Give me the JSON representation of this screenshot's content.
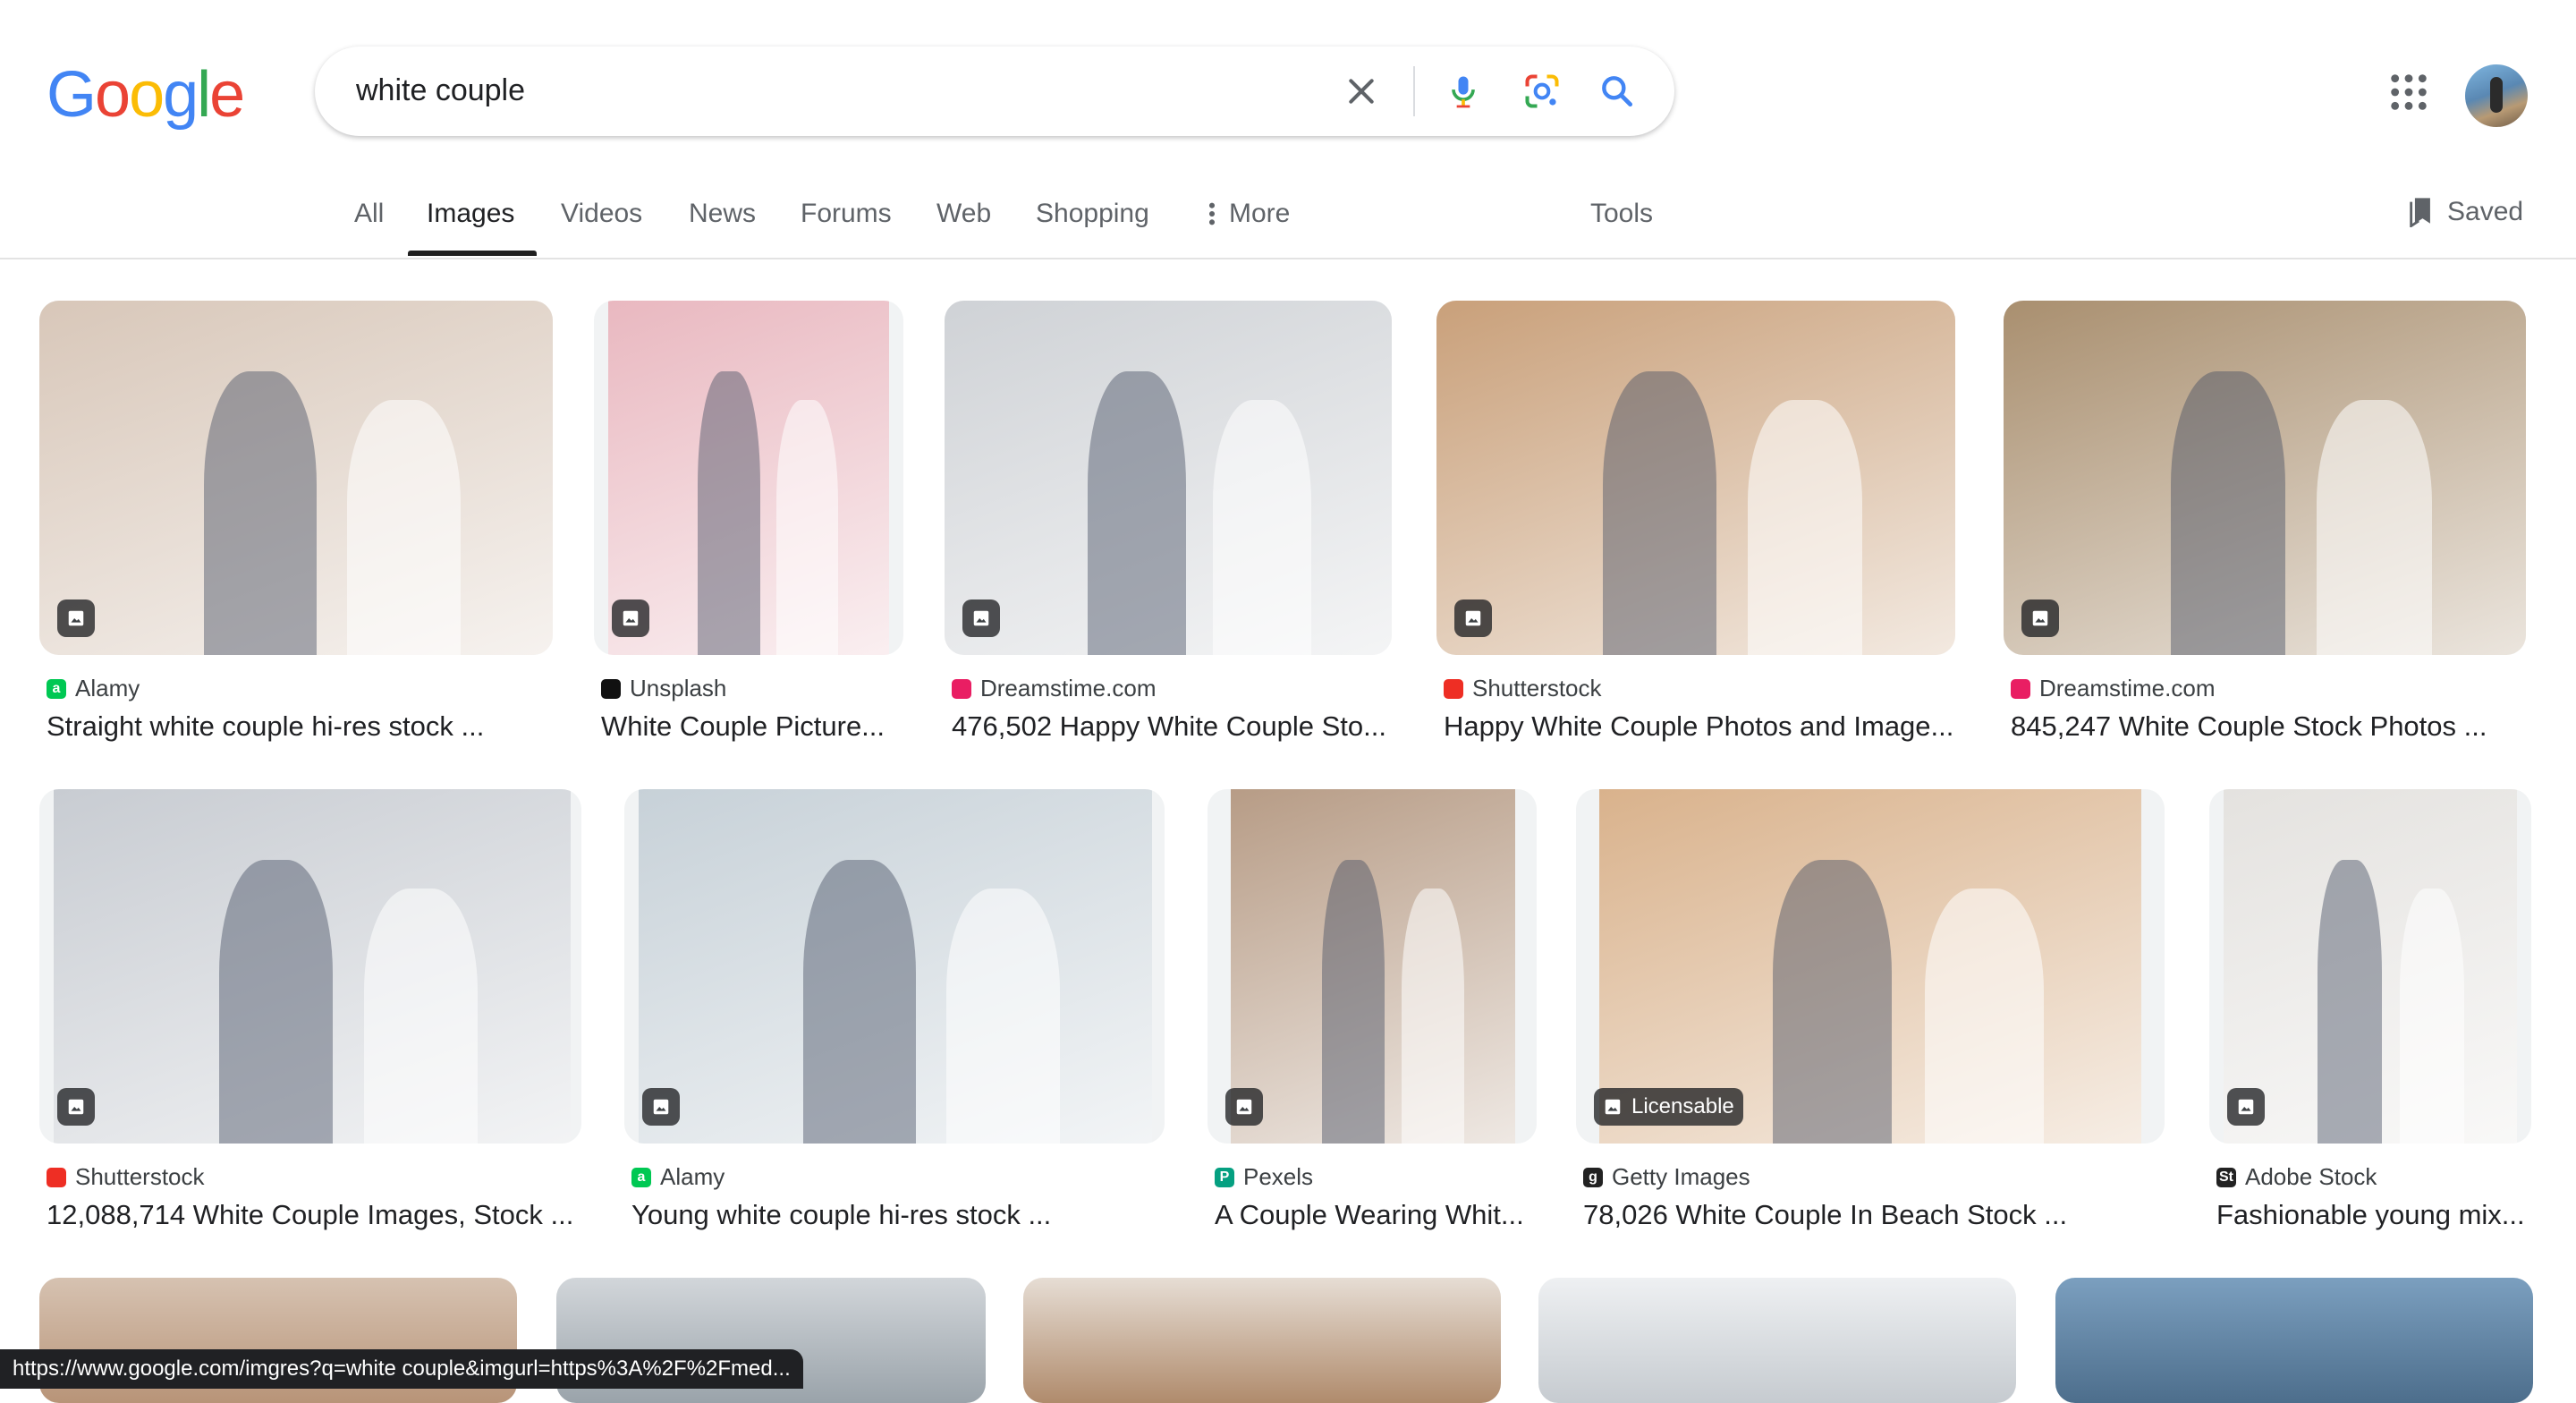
{
  "logo": {
    "letters": [
      "G",
      "o",
      "o",
      "g",
      "l",
      "e"
    ],
    "colors": [
      "#4285F4",
      "#EA4335",
      "#FBBC05",
      "#4285F4",
      "#34A853",
      "#EA4335"
    ]
  },
  "search": {
    "query": "white couple"
  },
  "tabs": [
    {
      "label": "All"
    },
    {
      "label": "Images"
    },
    {
      "label": "Videos"
    },
    {
      "label": "News"
    },
    {
      "label": "Forums"
    },
    {
      "label": "Web"
    },
    {
      "label": "Shopping"
    },
    {
      "label": "More"
    },
    {
      "label": "Tools"
    }
  ],
  "active_tab": "Images",
  "saved": {
    "label": "Saved"
  },
  "results": [
    {
      "source": "Alamy",
      "title": "Straight white couple hi-res stock ...",
      "favicon_color": "#00c853",
      "favicon_text": "a",
      "tint": "#d8c7b9"
    },
    {
      "source": "Unsplash",
      "title": "White Couple Picture...",
      "favicon_color": "#111111",
      "favicon_text": "",
      "tint": "#e9b8c0"
    },
    {
      "source": "Dreamstime.com",
      "title": "476,502 Happy White Couple Sto...",
      "favicon_color": "#e91e63",
      "favicon_text": "",
      "tint": "#cfd2d6"
    },
    {
      "source": "Shutterstock",
      "title": "Happy White Couple Photos and Image...",
      "favicon_color": "#ee2e24",
      "favicon_text": "",
      "tint": "#c9a07a"
    },
    {
      "source": "Dreamstime.com",
      "title": "845,247 White Couple Stock Photos ...",
      "favicon_color": "#e91e63",
      "favicon_text": "",
      "tint": "#a98f6f"
    },
    {
      "source": "Shutterstock",
      "title": "12,088,714 White Couple Images, Stock ...",
      "favicon_color": "#ee2e24",
      "favicon_text": "",
      "tint": "#c8ccd2"
    },
    {
      "source": "Alamy",
      "title": "Young white couple hi-res stock ...",
      "favicon_color": "#00c853",
      "favicon_text": "a",
      "tint": "#c7d1d8"
    },
    {
      "source": "Pexels",
      "title": "A Couple Wearing Whit...",
      "favicon_color": "#05a081",
      "favicon_text": "P",
      "tint": "#b79c86"
    },
    {
      "source": "Getty Images",
      "title": "78,026 White Couple In Beach Stock ...",
      "favicon_color": "#222222",
      "favicon_text": "g",
      "tint": "#d9b28c",
      "badge": "Licensable"
    },
    {
      "source": "Adobe Stock",
      "title": "Fashionable young mix...",
      "favicon_color": "#222222",
      "favicon_text": "St",
      "tint": "#e4e2df"
    }
  ],
  "status_url": "https://www.google.com/imgres?q=white couple&imgurl=https%3A%2F%2Fmed..."
}
